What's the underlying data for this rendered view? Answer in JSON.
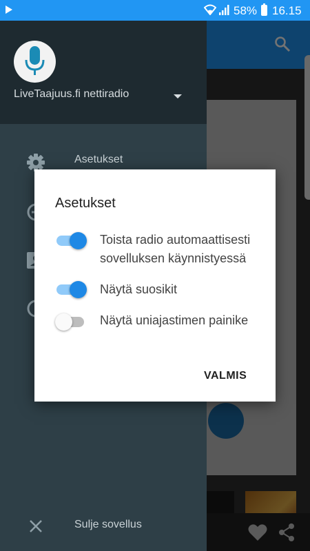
{
  "status_bar": {
    "battery": "58%",
    "time": "16.15"
  },
  "drawer": {
    "app_name": "LiveTaajuus.fi nettiradio",
    "items": [
      {
        "label": "Asetukset",
        "icon": "gear-icon"
      },
      {
        "label": "",
        "icon": "clock-icon"
      },
      {
        "label": "",
        "icon": "contact-icon"
      },
      {
        "label": "",
        "icon": "info-icon"
      }
    ],
    "close_label": "Sulje sovellus"
  },
  "dialog": {
    "title": "Asetukset",
    "options": [
      {
        "label": "Toista radio automaattisesti sovelluksen käynnistyessä",
        "checked": true
      },
      {
        "label": "Näytä suosikit",
        "checked": true
      },
      {
        "label": "Näytä uniajastimen painike",
        "checked": false
      }
    ],
    "done_label": "VALMIS"
  },
  "colors": {
    "accent": "#2196F3",
    "switch_on": "#1E88E5",
    "drawer_bg": "#2e3f47",
    "drawer_header": "#1e2a30"
  }
}
